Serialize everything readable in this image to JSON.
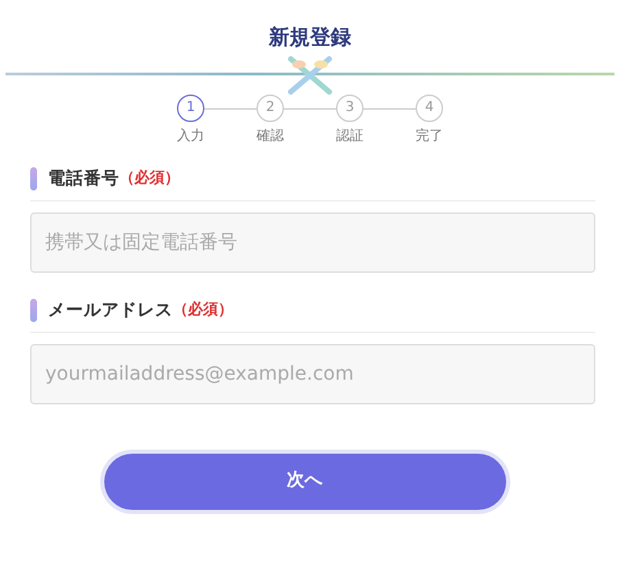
{
  "title": "新規登録",
  "steps": [
    {
      "number": "1",
      "label": "入力",
      "selected": true
    },
    {
      "number": "2",
      "label": "確認",
      "selected": false
    },
    {
      "number": "3",
      "label": "認証",
      "selected": false
    },
    {
      "number": "4",
      "label": "完了",
      "selected": false
    }
  ],
  "fields": [
    {
      "label": "電話番号",
      "required": "（必須）",
      "placeholder": "携帯又は固定電話番号"
    },
    {
      "label": "メールアドレス",
      "required": "（必須）",
      "placeholder": "yourmailaddress@example.com"
    }
  ],
  "button": "次へ"
}
